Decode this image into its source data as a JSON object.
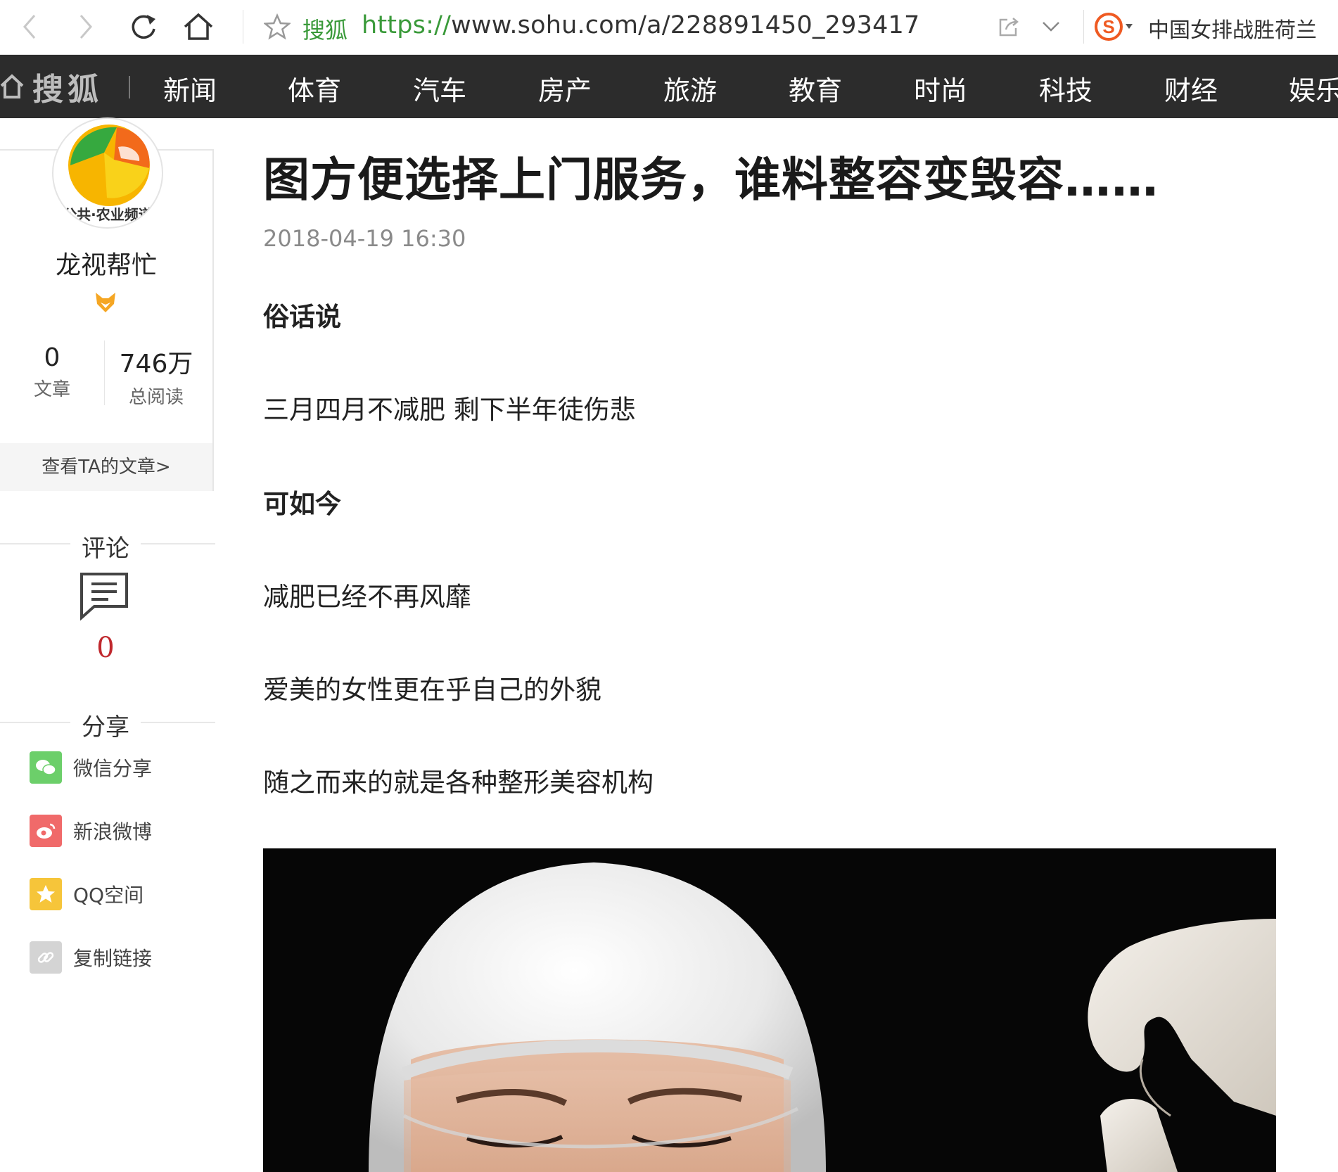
{
  "browser": {
    "site_name": "搜狐",
    "url_protocol": "https://",
    "url_rest": "www.sohu.com/a/228891450_293417",
    "search_hint": "中国女排战胜荷兰"
  },
  "nav": {
    "logo": "搜狐",
    "items": [
      "新闻",
      "体育",
      "汽车",
      "房产",
      "旅游",
      "教育",
      "时尚",
      "科技",
      "财经",
      "娱乐"
    ]
  },
  "author": {
    "avatar_text": "公共·农业频道",
    "name": "龙视帮忙",
    "articles_count": "0",
    "articles_label": "文章",
    "reads_count": "746万",
    "reads_label": "总阅读",
    "view_articles": "查看TA的文章>"
  },
  "comments": {
    "heading": "评论",
    "count": "0"
  },
  "share": {
    "heading": "分享",
    "items": [
      {
        "label": "微信分享",
        "icon": "wechat-icon",
        "color": "#6ccf6a"
      },
      {
        "label": "新浪微博",
        "icon": "weibo-icon",
        "color": "#f06a6a"
      },
      {
        "label": "QQ空间",
        "icon": "qzone-icon",
        "color": "#f6c53a"
      },
      {
        "label": "复制链接",
        "icon": "link-icon",
        "color": "#d4d4d4"
      }
    ]
  },
  "article": {
    "title": "图方便选择上门服务，谁料整容变毁容……",
    "date": "2018-04-19 16:30",
    "paragraphs": [
      {
        "text": "俗话说",
        "bold": true
      },
      {
        "text": "三月四月不减肥 剩下半年徒伤悲",
        "bold": false
      },
      {
        "text": "可如今",
        "bold": true
      },
      {
        "text": "减肥已经不再风靡",
        "bold": false
      },
      {
        "text": "爱美的女性更在乎自己的外貌",
        "bold": false
      },
      {
        "text": "随之而来的就是各种整形美容机构",
        "bold": false
      }
    ]
  },
  "colors": {
    "nav_bg": "#2c2c2c",
    "site_green": "#3a9a3a",
    "comment_red": "#c0282d"
  }
}
